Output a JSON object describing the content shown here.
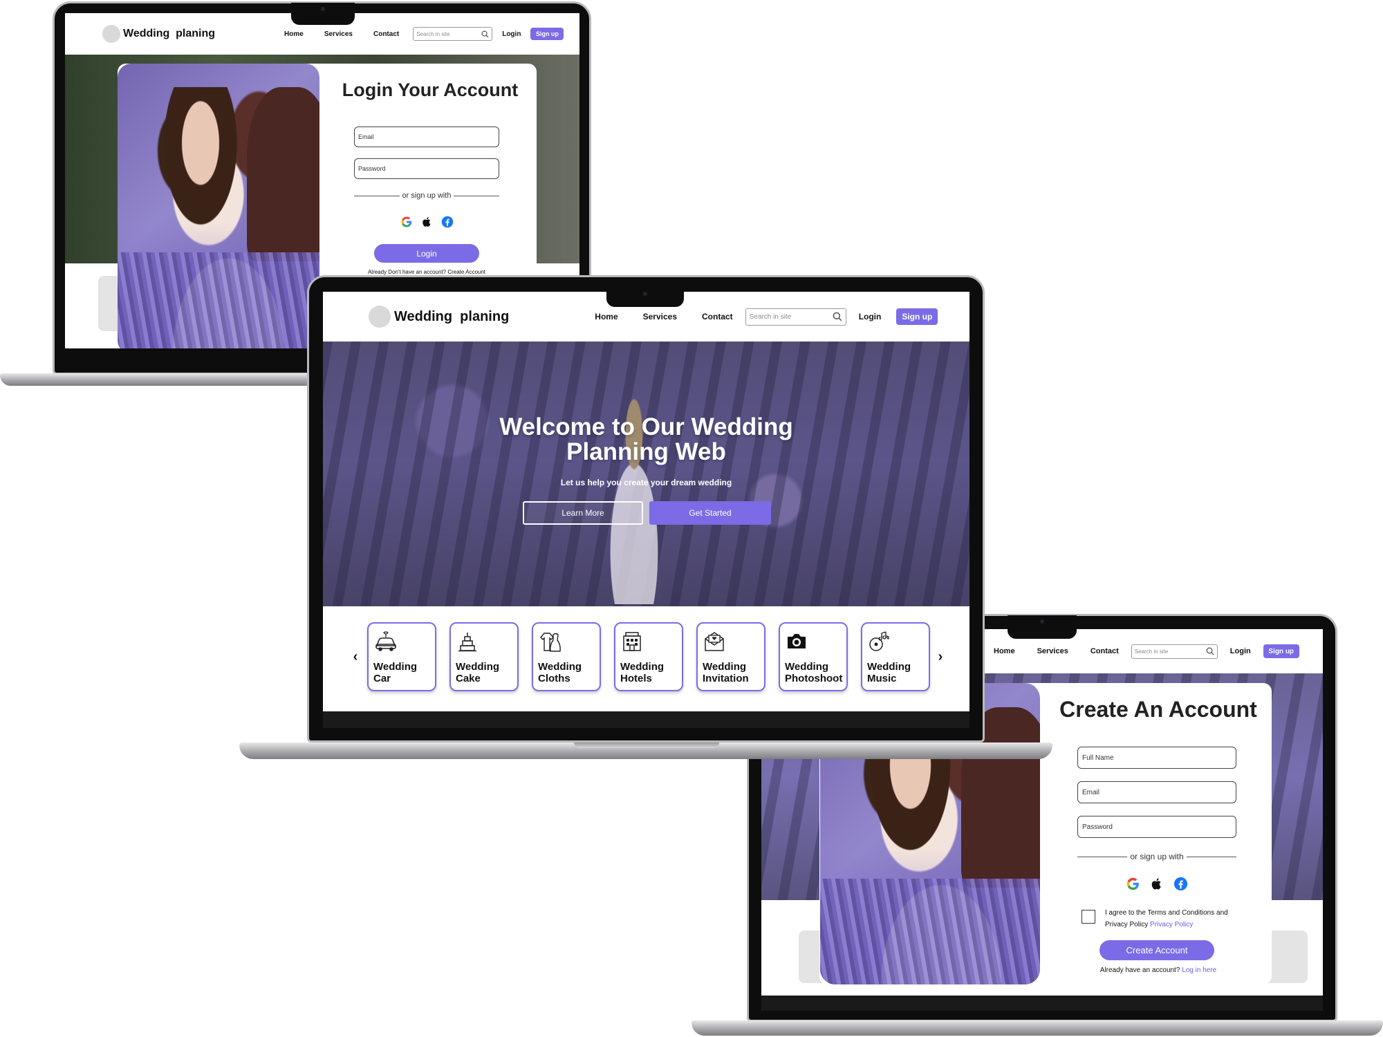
{
  "brand": {
    "name": "Wedding  planing"
  },
  "nav": {
    "links": [
      "Home",
      "Services",
      "Contact"
    ],
    "search_placeholder": "Search in site",
    "login": "Login",
    "signup": "Sign up"
  },
  "login_page": {
    "title": "Login Your Account",
    "email_placeholder": "Email",
    "password_placeholder": "Password",
    "divider": "or sign up with",
    "button": "Login",
    "footer": "Already Don't have an account? Create Account"
  },
  "home_page": {
    "hero_title_line1": "Welcome to Our Wedding",
    "hero_title_line2": "Planning Web",
    "hero_subtitle": "Let us help you create your dream wedding",
    "learn_more": "Learn More",
    "get_started": "Get Started",
    "services": [
      {
        "line1": "Wedding",
        "line2": "Car",
        "icon": "car-icon"
      },
      {
        "line1": "Wedding",
        "line2": "Cake",
        "icon": "cake-icon"
      },
      {
        "line1": "Wedding",
        "line2": "Cloths",
        "icon": "clothes-icon"
      },
      {
        "line1": "Wedding",
        "line2": "Hotels",
        "icon": "hotel-icon"
      },
      {
        "line1": "Wedding",
        "line2": "Invitation",
        "icon": "envelope-icon"
      },
      {
        "line1": "Wedding",
        "line2": "Photoshoot",
        "icon": "camera-icon"
      },
      {
        "line1": "Wedding",
        "line2": "Music",
        "icon": "music-icon"
      }
    ],
    "prev_arrow": "‹",
    "next_arrow": "›"
  },
  "signup_page": {
    "title": "Create An Account",
    "fullname_placeholder": "Full Name",
    "email_placeholder": "Email",
    "password_placeholder": "Password",
    "divider": "or sign up with",
    "terms_text": "I agree to the Terms and Conditions and",
    "terms_text2": "Privacy Policy",
    "privacy_link": "Privacy Policy",
    "button": "Create Account",
    "footer_text": "Already have an account?",
    "footer_link": "Log in here"
  },
  "colors": {
    "accent": "#7b6be6",
    "link": "#6b5ce7"
  }
}
